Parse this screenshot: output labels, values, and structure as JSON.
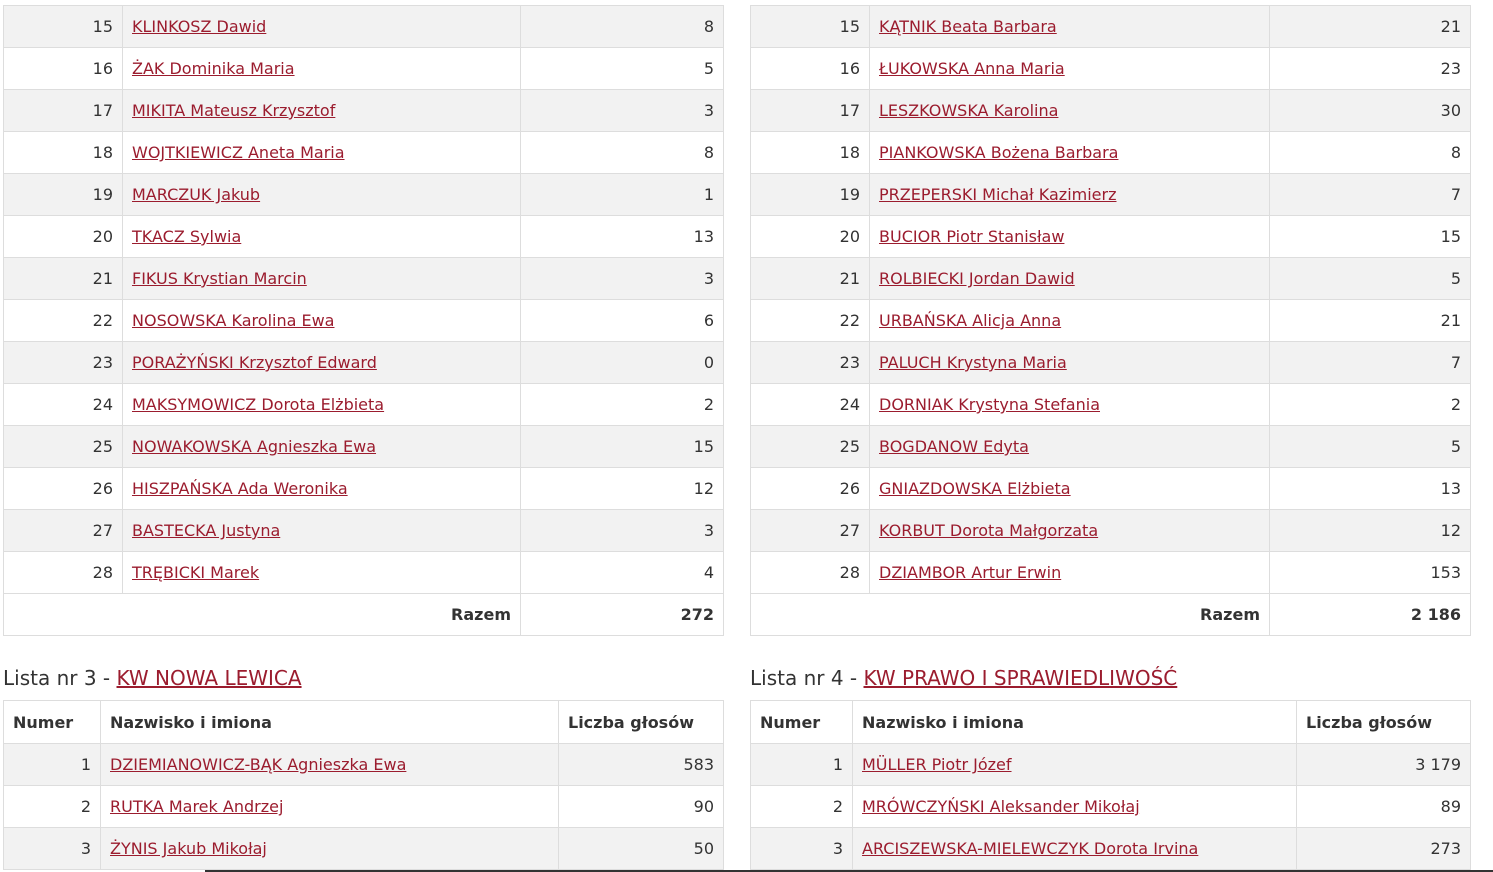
{
  "table_left": {
    "rows": [
      {
        "num": "15",
        "name": "KLINKOSZ Dawid",
        "votes": "8"
      },
      {
        "num": "16",
        "name": "ŻAK Dominika Maria",
        "votes": "5"
      },
      {
        "num": "17",
        "name": "MIKITA Mateusz Krzysztof",
        "votes": "3"
      },
      {
        "num": "18",
        "name": "WOJTKIEWICZ Aneta Maria",
        "votes": "8"
      },
      {
        "num": "19",
        "name": "MARCZUK Jakub",
        "votes": "1"
      },
      {
        "num": "20",
        "name": "TKACZ Sylwia",
        "votes": "13"
      },
      {
        "num": "21",
        "name": "FIKUS Krystian Marcin",
        "votes": "3"
      },
      {
        "num": "22",
        "name": "NOSOWSKA Karolina Ewa",
        "votes": "6"
      },
      {
        "num": "23",
        "name": "PORAŻYŃSKI Krzysztof Edward",
        "votes": "0"
      },
      {
        "num": "24",
        "name": "MAKSYMOWICZ Dorota Elżbieta",
        "votes": "2"
      },
      {
        "num": "25",
        "name": "NOWAKOWSKA Agnieszka Ewa",
        "votes": "15"
      },
      {
        "num": "26",
        "name": "HISZPAŃSKA Ada Weronika",
        "votes": "12"
      },
      {
        "num": "27",
        "name": "BASTECKA Justyna",
        "votes": "3"
      },
      {
        "num": "28",
        "name": "TRĘBICKI Marek",
        "votes": "4"
      }
    ],
    "total_label": "Razem",
    "total_value": "272"
  },
  "table_right": {
    "rows": [
      {
        "num": "15",
        "name": "KĄTNIK Beata Barbara",
        "votes": "21"
      },
      {
        "num": "16",
        "name": "ŁUKOWSKA Anna Maria",
        "votes": "23"
      },
      {
        "num": "17",
        "name": "LESZKOWSKA Karolina",
        "votes": "30"
      },
      {
        "num": "18",
        "name": "PIANKOWSKA Bożena Barbara",
        "votes": "8"
      },
      {
        "num": "19",
        "name": "PRZEPERSKI Michał Kazimierz",
        "votes": "7"
      },
      {
        "num": "20",
        "name": "BUCIOR Piotr Stanisław",
        "votes": "15"
      },
      {
        "num": "21",
        "name": "ROLBIECKI Jordan Dawid",
        "votes": "5"
      },
      {
        "num": "22",
        "name": "URBAŃSKA Alicja Anna",
        "votes": "21"
      },
      {
        "num": "23",
        "name": "PALUCH Krystyna Maria",
        "votes": "7"
      },
      {
        "num": "24",
        "name": "DORNIAK Krystyna Stefania",
        "votes": "2"
      },
      {
        "num": "25",
        "name": "BOGDANOW Edyta",
        "votes": "5"
      },
      {
        "num": "26",
        "name": "GNIAZDOWSKA Elżbieta",
        "votes": "13"
      },
      {
        "num": "27",
        "name": "KORBUT Dorota Małgorzata",
        "votes": "12"
      },
      {
        "num": "28",
        "name": "DZIAMBOR Artur Erwin",
        "votes": "153"
      }
    ],
    "total_label": "Razem",
    "total_value": "2 186"
  },
  "list3": {
    "prefix": "Lista nr 3 - ",
    "committee": "KW NOWA LEWICA",
    "headers": {
      "num": "Numer",
      "name": "Nazwisko i imiona",
      "votes": "Liczba głosów"
    },
    "rows": [
      {
        "num": "1",
        "name": "DZIEMIANOWICZ-BĄK Agnieszka Ewa",
        "votes": "583"
      },
      {
        "num": "2",
        "name": "RUTKA Marek Andrzej",
        "votes": "90"
      },
      {
        "num": "3",
        "name": "ŻYNIS Jakub Mikołaj",
        "votes": "50"
      }
    ]
  },
  "list4": {
    "prefix": "Lista nr 4 - ",
    "committee": "KW PRAWO I SPRAWIEDLIWOŚĆ",
    "headers": {
      "num": "Numer",
      "name": "Nazwisko i imiona",
      "votes": "Liczba głosów"
    },
    "rows": [
      {
        "num": "1",
        "name": "MÜLLER Piotr Józef",
        "votes": "3 179"
      },
      {
        "num": "2",
        "name": "MRÓWCZYŃSKI Aleksander Mikołaj",
        "votes": "89"
      },
      {
        "num": "3",
        "name": "ARCISZEWSKA-MIELEWCZYK Dorota Irvina",
        "votes": "273"
      }
    ]
  },
  "colors": {
    "link": "#9b1c2e",
    "row_stripe": "#f2f2f2",
    "border": "#dddddd",
    "text": "#333333"
  }
}
